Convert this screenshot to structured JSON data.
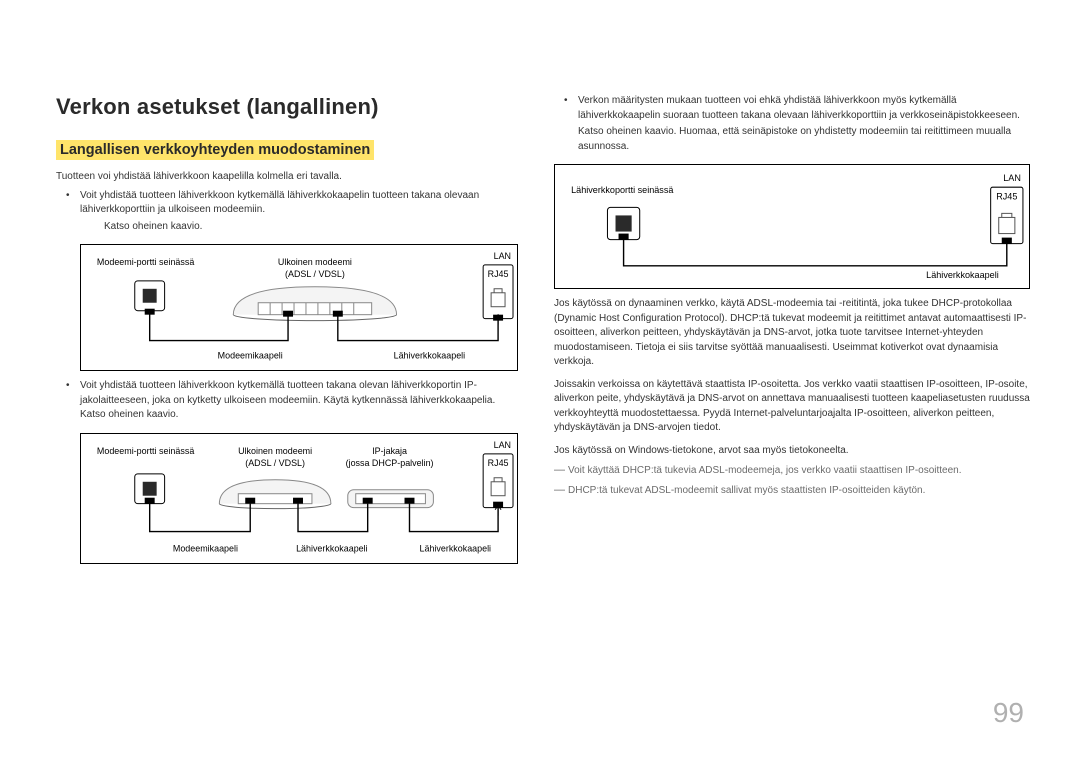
{
  "heading": "Verkon asetukset (langallinen)",
  "subheading": "Langallisen verkkoyhteyden muodostaminen",
  "intro": "Tuotteen voi yhdistää lähiverkkoon kaapelilla kolmella eri tavalla.",
  "bullet1_a": "Voit yhdistää tuotteen lähiverkkoon kytkemällä lähiverkkokaapelin tuotteen takana olevaan lähiverkkoporttiin ja ulkoiseen modeemiin.",
  "bullet1_b": "Katso oheinen kaavio.",
  "diagram1": {
    "wall_label": "Modeemi-portti seinässä",
    "modem_label_1": "Ulkoinen modeemi",
    "modem_label_2": "(ADSL / VDSL)",
    "lan": "LAN",
    "rj45": "RJ45",
    "cable1": "Modeemikaapeli",
    "cable2": "Lähiverkkokaapeli"
  },
  "bullet2": "Voit yhdistää tuotteen lähiverkkoon kytkemällä tuotteen takana olevan lähiverkkoportin IP-jakolaitteeseen, joka on kytketty ulkoiseen modeemiin. Käytä kytkennässä lähiverkkokaapelia. Katso oheinen kaavio.",
  "diagram2": {
    "wall_label": "Modeemi-portti seinässä",
    "modem_label_1": "Ulkoinen modeemi",
    "modem_label_2": "(ADSL / VDSL)",
    "ipshare_label_1": "IP-jakaja",
    "ipshare_label_2": "(jossa DHCP-palvelin)",
    "lan": "LAN",
    "rj45": "RJ45",
    "cable1": "Modeemikaapeli",
    "cable2": "Lähiverkkokaapeli",
    "cable3": "Lähiverkkokaapeli"
  },
  "bullet3_a": "Verkon määritysten mukaan tuotteen voi ehkä yhdistää lähiverkkoon myös kytkemällä lähiverkkokaapelin suoraan tuotteen takana olevaan lähiverkkoporttiin ja verkkoseinäpistokkeeseen.",
  "bullet3_b": "Katso oheinen kaavio. Huomaa, että seinäpistoke on yhdistetty modeemiin tai reitittimeen muualla asunnossa.",
  "diagram3": {
    "wall_label": "Lähiverkkoportti seinässä",
    "lan": "LAN",
    "rj45": "RJ45",
    "cable": "Lähiverkkokaapeli"
  },
  "para1": "Jos käytössä on dynaaminen verkko, käytä ADSL-modeemia tai -reititintä, joka tukee DHCP-protokollaa (Dynamic Host Configuration Protocol). DHCP:tä tukevat modeemit ja reitittimet antavat automaattisesti IP-osoitteen, aliverkon peitteen, yhdyskäytävän ja DNS-arvot, jotka tuote tarvitsee Internet-yhteyden muodostamiseen. Tietoja ei siis tarvitse syöttää manuaalisesti. Useimmat kotiverkot ovat dynaamisia verkkoja.",
  "para2": "Joissakin verkoissa on käytettävä staattista IP-osoitetta. Jos verkko vaatii staattisen IP-osoitteen, IP-osoite, aliverkon peite, yhdyskäytävä ja DNS-arvot on annettava manuaalisesti tuotteen kaapeliasetusten ruudussa verkkoyhteyttä muodostettaessa. Pyydä Internet-palveluntarjoajalta IP-osoitteen, aliverkon peitteen, yhdyskäytävän ja DNS-arvojen tiedot.",
  "para3": "Jos käytössä on Windows-tietokone, arvot saa myös tietokoneelta.",
  "note1": "Voit käyttää DHCP:tä tukevia ADSL-modeemeja, jos verkko vaatii staattisen IP-osoitteen.",
  "note2": "DHCP:tä tukevat ADSL-modeemit sallivat myös staattisten IP-osoitteiden käytön.",
  "page_number": "99"
}
